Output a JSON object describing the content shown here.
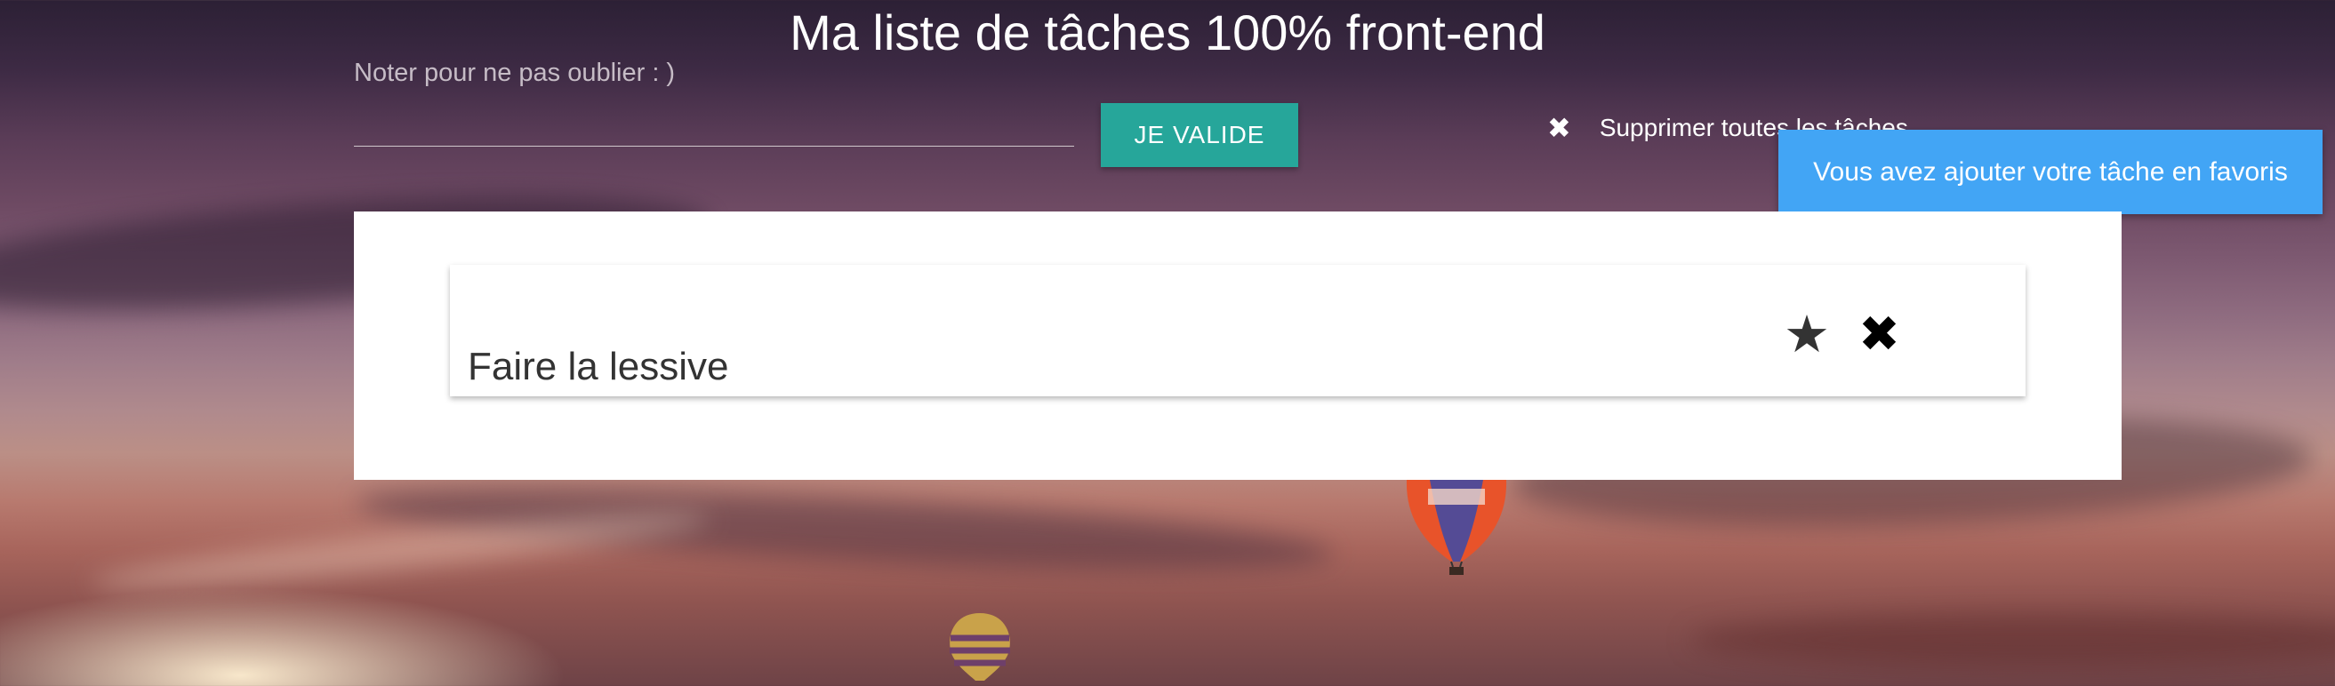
{
  "header": {
    "title": "Ma liste de tâches 100% front-end"
  },
  "form": {
    "label": "Noter pour ne pas oublier : )",
    "input_value": "",
    "submit_label": "JE VALIDE"
  },
  "toolbar": {
    "delete_all_icon": "close-icon",
    "delete_all_label": "Supprimer toutes les tâches"
  },
  "toast": {
    "message": "Vous avez ajouter votre tâche en favoris"
  },
  "tasks": [
    {
      "text": "Faire la lessive",
      "favorite_icon": "★",
      "delete_icon": "✖"
    }
  ],
  "colors": {
    "button": "#26a69a",
    "toast": "#42a5f5",
    "panel": "#ffffff"
  }
}
